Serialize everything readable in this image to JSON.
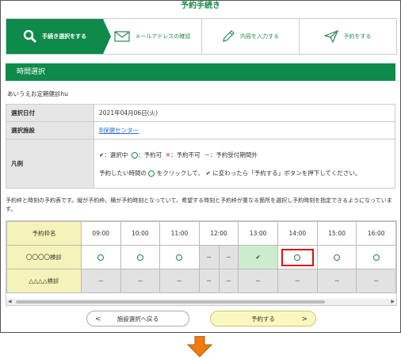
{
  "header": {
    "title": "予約手続き"
  },
  "steps": [
    {
      "label": "手続き選択をする",
      "icon": "search-icon",
      "active": true
    },
    {
      "label": "メールアドレスの確認",
      "icon": "mail-icon",
      "active": false
    },
    {
      "label": "内容を入力する",
      "icon": "pencil-icon",
      "active": false
    },
    {
      "label": "予約をする",
      "icon": "send-icon",
      "active": false
    }
  ],
  "section": {
    "title": "時間選択"
  },
  "exam_name": "あいうえお定期健診hu",
  "info": {
    "date_label": "選択日付",
    "date_value": "2021年04月06日(火)",
    "facility_label": "選択施設",
    "facility_value": "B保健センター",
    "legend_label": "凡例",
    "legend_selected": "：選択中",
    "legend_available": "：予約可",
    "legend_unavailable": "：予約不可",
    "legend_outside_dash": "－",
    "legend_outside": "：予約受付期間外",
    "instruction_1": "予約したい時間の",
    "instruction_2": "をクリックして、",
    "instruction_3": "に変わったら「予約する」ボタンを押下してください。"
  },
  "description": "予約枠と時刻の予約表です。縦が予約枠、横が予約時刻となっていて、希望する時刻と予約枠が重なる箇所を選択し予約時刻を指定できるようになっています。",
  "slots": {
    "header_label": "予約枠名",
    "times": [
      "09:00",
      "10:00",
      "11:00",
      "12:00",
      "13:00",
      "14:00",
      "15:00",
      "16:00"
    ],
    "rows": [
      {
        "name": "〇〇〇〇検診"
      },
      {
        "name": "△△△△検診"
      }
    ],
    "dash": "－",
    "check": "✔"
  },
  "buttons": {
    "back_label": "施設選択へ戻る",
    "back_chevron": "<",
    "next_label": "予約する",
    "next_chevron": ">"
  },
  "colors": {
    "brand_green": "#0e8a4a",
    "highlight_red": "#e01010",
    "arrow_orange": "#f07c12"
  }
}
